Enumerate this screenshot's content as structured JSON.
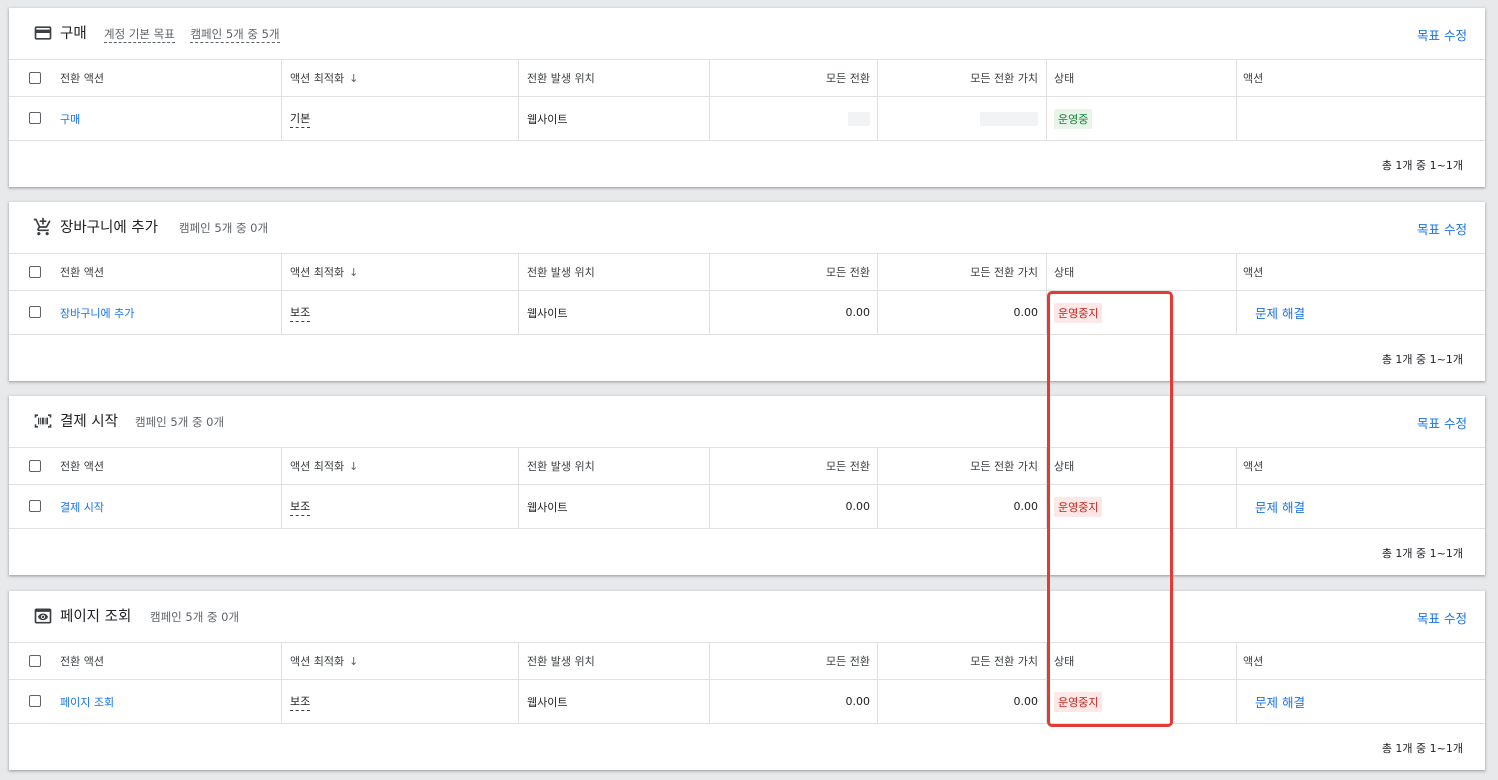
{
  "edit_goal_label": "목표 수정",
  "columns": {
    "action": "전환 액션",
    "optimization": "액션 최적화",
    "sort_icon": "arrow-down-icon",
    "source": "전환 발생 위치",
    "all_conv": "모든 전환",
    "all_value": "모든 전환 가치",
    "status": "상태",
    "actions": "액션"
  },
  "colors": {
    "accent": "#1a73e8",
    "ok_text": "#188038",
    "ok_bg": "#e6f4ea",
    "bad_text": "#c5221f",
    "bad_bg": "#fce8e6",
    "highlight": "#e53935"
  },
  "sections": [
    {
      "icon": "credit-card-icon",
      "title": "구매",
      "account_default": "계정 기본 목표",
      "campaigns": "캠페인 5개 중 5개",
      "row": {
        "action": "구매",
        "optimization": "기본",
        "source": "웹사이트",
        "all_conv": "",
        "all_value": "",
        "status": "운영중",
        "status_kind": "ok",
        "action_link": ""
      },
      "pager": "총 1개 중 1~1개"
    },
    {
      "icon": "add-shopping-cart-icon",
      "title": "장바구니에 추가",
      "campaigns": "캠페인 5개 중 0개",
      "row": {
        "action": "장바구니에 추가",
        "optimization": "보조",
        "source": "웹사이트",
        "all_conv": "0.00",
        "all_value": "0.00",
        "status": "운영중지",
        "status_kind": "bad",
        "action_link": "문제 해결"
      },
      "pager": "총 1개 중 1~1개"
    },
    {
      "icon": "barcode-scanner-icon",
      "title": "결제 시작",
      "campaigns": "캠페인 5개 중 0개",
      "row": {
        "action": "결제 시작",
        "optimization": "보조",
        "source": "웹사이트",
        "all_conv": "0.00",
        "all_value": "0.00",
        "status": "운영중지",
        "status_kind": "bad",
        "action_link": "문제 해결"
      },
      "pager": "총 1개 중 1~1개"
    },
    {
      "icon": "page-view-icon",
      "title": "페이지 조회",
      "campaigns": "캠페인 5개 중 0개",
      "row": {
        "action": "페이지 조회",
        "optimization": "보조",
        "source": "웹사이트",
        "all_conv": "0.00",
        "all_value": "0.00",
        "status": "운영중지",
        "status_kind": "bad",
        "action_link": "문제 해결"
      },
      "pager": "총 1개 중 1~1개"
    }
  ]
}
